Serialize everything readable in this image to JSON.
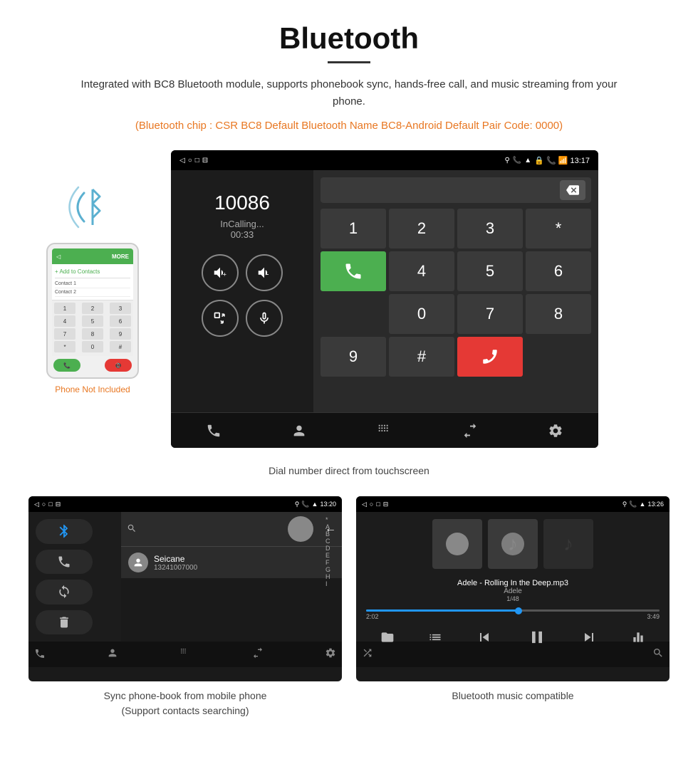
{
  "page": {
    "title": "Bluetooth",
    "underline": true
  },
  "description": {
    "main": "Integrated with BC8 Bluetooth module, supports phonebook sync, hands-free call, and music streaming from your phone.",
    "orange": "(Bluetooth chip : CSR BC8    Default Bluetooth Name BC8-Android    Default Pair Code: 0000)"
  },
  "phone_label": "Phone Not Included",
  "dial_caption": "Dial number direct from touchscreen",
  "phonebook_caption": "Sync phone-book from mobile phone\n(Support contacts searching)",
  "music_caption": "Bluetooth music compatible",
  "dialer": {
    "number": "10086",
    "status": "InCalling...",
    "timer": "00:33",
    "keys": [
      "1",
      "2",
      "3",
      "*",
      "4",
      "5",
      "6",
      "0",
      "7",
      "8",
      "9",
      "#"
    ],
    "call_icon": "📞",
    "end_icon": "📵"
  },
  "status_bar": {
    "left": "◁  ○  □  ⊟",
    "right_1": "🔒  📞  📶  13:17",
    "right_2": "🔒  📞  📶  13:20",
    "right_3": "🔒  📞  📶  13:26"
  },
  "phonebook": {
    "contact_name": "Seicane",
    "contact_number": "13241007000"
  },
  "music": {
    "song": "Adele - Rolling In the Deep.mp3",
    "artist": "Adele",
    "track_info": "1/48",
    "time_current": "2:02",
    "time_total": "3:49",
    "progress_pct": 52
  },
  "bottom_bar_icons": [
    "📞",
    "👤",
    "⊞",
    "📤",
    "⚙"
  ],
  "colors": {
    "orange": "#e87722",
    "green": "#4caf50",
    "red": "#e53935",
    "blue": "#2196f3",
    "dark_bg": "#1a1a1a",
    "darker": "#111"
  }
}
